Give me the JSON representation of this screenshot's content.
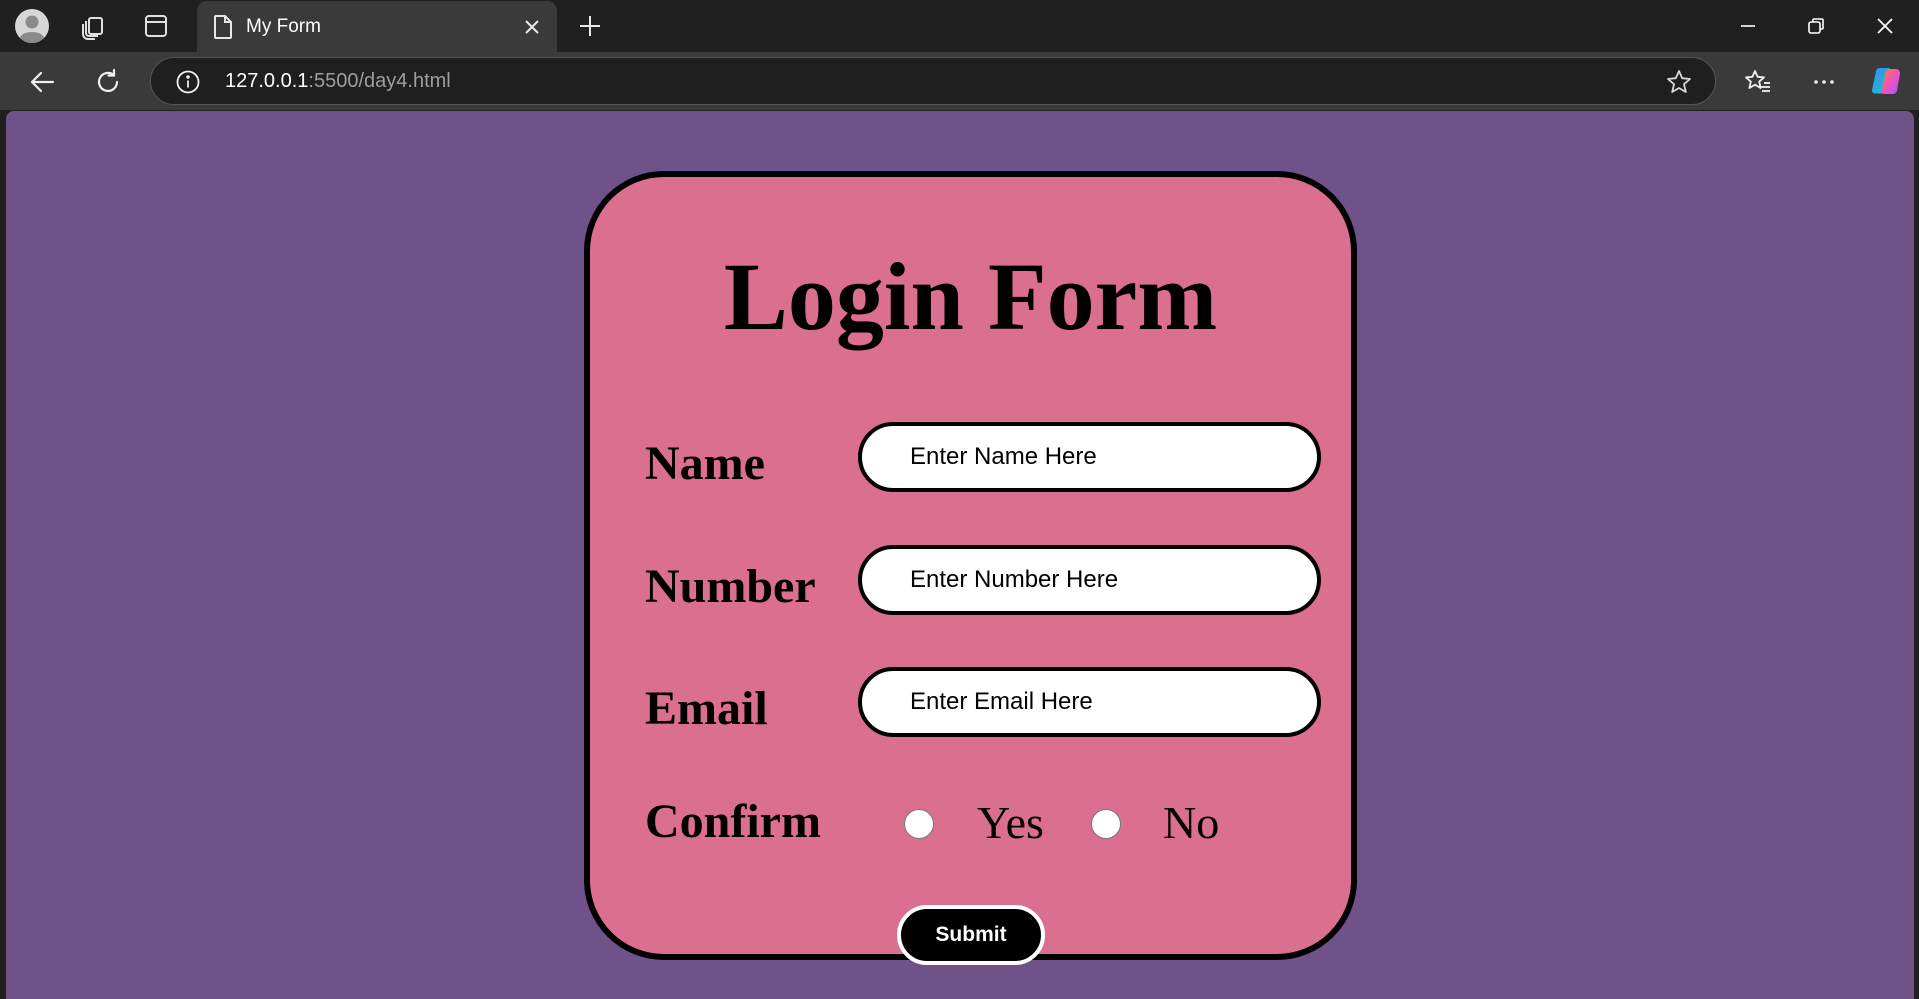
{
  "browser": {
    "tab": {
      "title": "My Form"
    },
    "address": {
      "host": "127.0.0.1",
      "rest": ":5500/day4.html"
    },
    "icons": {
      "profile": "profile-icon",
      "workspaces": "workspaces-icon",
      "vertical_tabs": "vertical-tabs-icon",
      "tab_document": "document-icon",
      "tab_close": "close-icon",
      "new_tab": "plus-icon",
      "back": "arrow-left-icon",
      "reload": "reload-icon",
      "site_info": "info-icon",
      "favorite": "star-icon",
      "favorites": "favorites-icon",
      "more": "more-icon",
      "copilot": "copilot-icon"
    }
  },
  "page": {
    "background": "#6f528a",
    "card_color": "#db6f8f",
    "title": "Login Form",
    "fields": {
      "name": {
        "label": "Name",
        "placeholder": "Enter Name Here"
      },
      "number": {
        "label": "Number",
        "placeholder": "Enter Number Here"
      },
      "email": {
        "label": "Email",
        "placeholder": "Enter Email Here"
      }
    },
    "confirm": {
      "label": "Confirm",
      "options": [
        "Yes",
        "No"
      ]
    },
    "submit_label": "Submit"
  }
}
